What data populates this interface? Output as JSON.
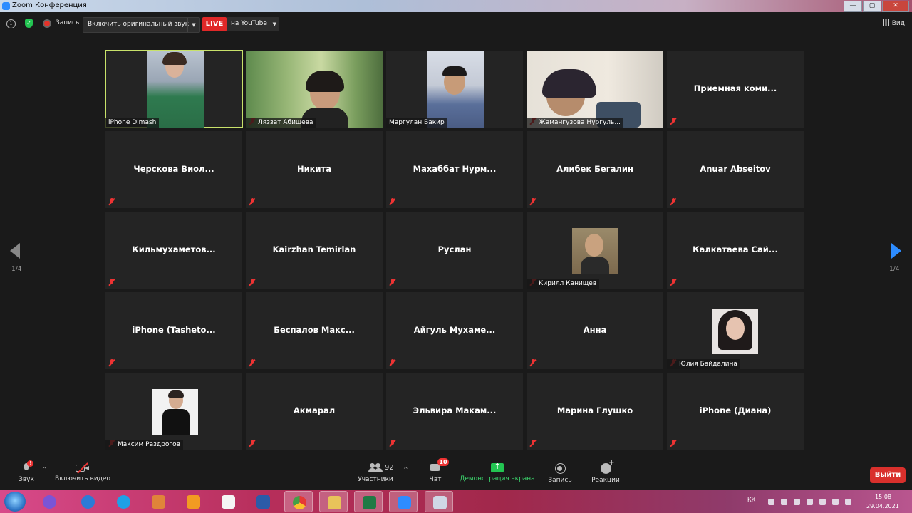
{
  "window": {
    "title": "Zoom Конференция",
    "ctrl_min": "—",
    "ctrl_max": "▢",
    "ctrl_close": "✕"
  },
  "topbar": {
    "info_icon": "i",
    "record_label": "Запись",
    "original_sound_label": "Включить оригинальный звук",
    "live_label": "LIVE",
    "youtube_label": "на YouTube",
    "view_label": "Вид"
  },
  "pagination": {
    "left": "1/4",
    "right": "1/4"
  },
  "tiles": [
    {
      "name": "iPhone Dimash",
      "video": true,
      "muted": false,
      "active": true
    },
    {
      "name": "Ляззат Абишева",
      "video": true,
      "muted": true
    },
    {
      "name": "Маргулан Бакир",
      "video": true,
      "muted": false
    },
    {
      "name": "Жамангузова Нургуль...",
      "video": true,
      "muted": true
    },
    {
      "name": "Приемная коми...",
      "video": false,
      "muted": true
    },
    {
      "name": "Черскова Виол...",
      "video": false,
      "muted": true
    },
    {
      "name": "Никита",
      "video": false,
      "muted": true
    },
    {
      "name": "Махаббат Нурм...",
      "video": false,
      "muted": true
    },
    {
      "name": "Алибек Бегалин",
      "video": false,
      "muted": true
    },
    {
      "name": "Anuar Abseitov",
      "video": false,
      "muted": true
    },
    {
      "name": "Кильмухаметов...",
      "video": false,
      "muted": true
    },
    {
      "name": "Kairzhan Temirlan",
      "video": false,
      "muted": true
    },
    {
      "name": "Руслан",
      "video": false,
      "muted": true
    },
    {
      "name": "Кирилл Канищев",
      "video": false,
      "avatar": true,
      "muted": true
    },
    {
      "name": "Калкатаева Сай...",
      "video": false,
      "muted": true
    },
    {
      "name": "iPhone (Tasheto...",
      "video": false,
      "muted": true
    },
    {
      "name": "Беспалов Макс...",
      "video": false,
      "muted": true
    },
    {
      "name": "Айгуль Мухаме...",
      "video": false,
      "muted": true
    },
    {
      "name": "Анна",
      "video": false,
      "muted": true
    },
    {
      "name": "Юлия Байдалина",
      "video": false,
      "avatar": true,
      "muted": true
    },
    {
      "name": "Максим Раздрогов",
      "video": false,
      "avatar": true,
      "muted": true
    },
    {
      "name": "Акмарал",
      "video": false,
      "muted": true
    },
    {
      "name": "Эльвира Макам...",
      "video": false,
      "muted": true
    },
    {
      "name": "Марина Глушко",
      "video": false,
      "muted": true
    },
    {
      "name": "iPhone (Диана)",
      "video": false,
      "muted": true
    }
  ],
  "bottombar": {
    "audio_label": "Звук",
    "audio_badge": "!",
    "video_label": "Включить видео",
    "participants_label": "Участники",
    "participants_count": "92",
    "chat_label": "Чат",
    "chat_badge": "10",
    "share_label": "Демонстрация экрана",
    "record_label": "Запись",
    "reactions_label": "Реакции",
    "exit_label": "Выйти",
    "caret": "^"
  },
  "taskbar": {
    "lang": "КК",
    "time": "15:08",
    "date": "29.04.2021",
    "apps": [
      "start-orb",
      "yandex-browser",
      "ie",
      "skype",
      "media",
      "ok",
      "yandex",
      "word",
      "chrome",
      "explorer",
      "excel",
      "zoom",
      "paint"
    ]
  },
  "colors": {
    "live": "#e02828",
    "accent": "#2d8cff",
    "active_outline": "#c8e26a",
    "share": "#23c552",
    "exit": "#d9302c"
  }
}
